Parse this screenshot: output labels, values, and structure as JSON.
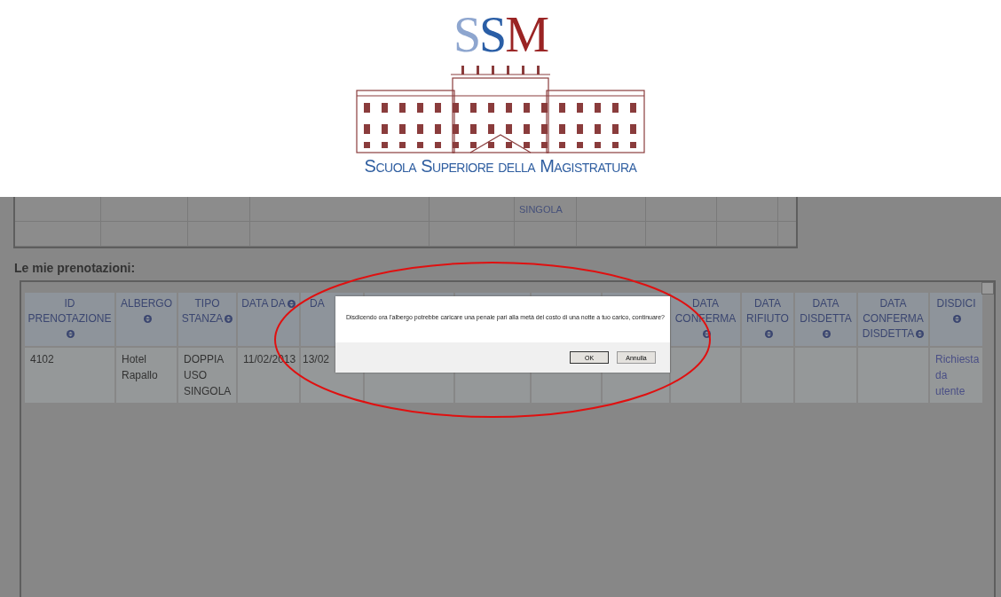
{
  "logo": {
    "letters": "SSM",
    "tagline": "Scuola Superiore della Magistratura"
  },
  "top_table": {
    "rows": [
      {
        "column_6": "SINGOLA"
      }
    ]
  },
  "section_title": "Le mie prenotazioni:",
  "table": {
    "columns": [
      {
        "label": "ID PRENOTAZIONE",
        "sortable": true
      },
      {
        "label": "ALBERGO",
        "sortable": true
      },
      {
        "label": "TIPO STANZA",
        "sortable": true
      },
      {
        "label": "DATA DA",
        "sortable": true
      },
      {
        "label": "DA"
      },
      {},
      {},
      {},
      {},
      {
        "label": "DATA CONFERMA",
        "sortable": true
      },
      {
        "label": "DATA RIFIUTO",
        "sortable": true
      },
      {
        "label": "DATA DISDETTA",
        "sortable": true
      },
      {
        "label": "DATA CONFERMA DISDETTA",
        "sortable": true
      },
      {
        "label": "DISDICI",
        "sortable": true
      }
    ],
    "rows": [
      {
        "cells": [
          "4102",
          "Hotel Rapallo",
          "DOPPIA USO SINGOLA",
          "11/02/2013",
          "13/02",
          null,
          null,
          null,
          null,
          null,
          null,
          null,
          null,
          "Richiesta da utente"
        ]
      }
    ]
  },
  "dialog": {
    "message": "Disdicendo ora l'albergo potrebbe caricare una penale pari alla metà del costo di una notte a tuo carico, continuare?",
    "buttons": [
      {
        "label": "OK",
        "focused": true
      },
      {
        "label": "Annulla",
        "focused": false
      }
    ]
  }
}
